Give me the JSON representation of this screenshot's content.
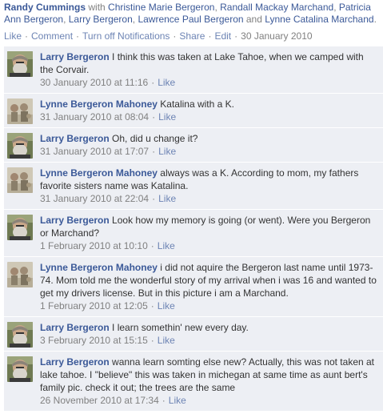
{
  "post": {
    "author": "Randy Cummings",
    "with_word": "with",
    "tagged": [
      {
        "name": "Christine Marie Bergeron",
        "after": ", "
      },
      {
        "name": "Randall Mackay Marchand",
        "after": ", "
      },
      {
        "name": "Patricia Ann Bergeron",
        "after": ", "
      },
      {
        "name": "Larry Bergeron",
        "after": ", "
      },
      {
        "name": "Lawrence Paul Bergeron",
        "after": " and "
      },
      {
        "name": "Lynne Catalina Marchand",
        "after": "."
      }
    ],
    "actions": {
      "like": "Like",
      "comment": "Comment",
      "notifications": "Turn off Notifications",
      "share": "Share",
      "edit": "Edit",
      "separator": "·",
      "date": "30 January 2010"
    }
  },
  "comments": [
    {
      "author": "Larry Bergeron",
      "avatar": "larry",
      "text": "I think this was taken at Lake Tahoe, when we camped with the Corvair.",
      "time": "30 January 2010 at 11:16",
      "like": "Like"
    },
    {
      "author": "Lynne Bergeron Mahoney",
      "avatar": "lynne",
      "text": "Katalina with a K.",
      "time": "31 January 2010 at 08:04",
      "like": "Like"
    },
    {
      "author": "Larry Bergeron",
      "avatar": "larry",
      "text": "Oh, did u change it?",
      "time": "31 January 2010 at 17:07",
      "like": "Like"
    },
    {
      "author": "Lynne Bergeron Mahoney",
      "avatar": "lynne",
      "text": "always was a K. According to mom, my fathers favorite sisters name was Katalina.",
      "time": "31 January 2010 at 22:04",
      "like": "Like"
    },
    {
      "author": "Larry Bergeron",
      "avatar": "larry",
      "text": "Look how my memory is going (or went). Were you Bergeron or Marchand?",
      "time": "1 February 2010 at 10:10",
      "like": "Like"
    },
    {
      "author": "Lynne Bergeron Mahoney",
      "avatar": "lynne",
      "text": "i did not aquire the Bergeron last name until 1973-74. Mom told me the wonderful story of my arrival when i was 16 and wanted to get my drivers license. But in this picture i am a Marchand.",
      "time": "1 February 2010 at 12:05",
      "like": "Like"
    },
    {
      "author": "Larry Bergeron",
      "avatar": "larry",
      "text": "I learn somethin' new every day.",
      "time": "3 February 2010 at 15:15",
      "like": "Like"
    },
    {
      "author": "Larry Bergeron",
      "avatar": "larry",
      "text": "wanna learn somting else new? Actually, this was not taken at lake tahoe. I \"believe\" this was taken in michegan at same time as aunt bert's family pic. check it out; the trees are the same",
      "time": "26 November 2010 at 17:34",
      "like": "Like"
    }
  ],
  "colors": {
    "link": "#3b5998",
    "action": "#6d84b4",
    "comment_bg": "#edeff4",
    "muted": "#808080"
  }
}
